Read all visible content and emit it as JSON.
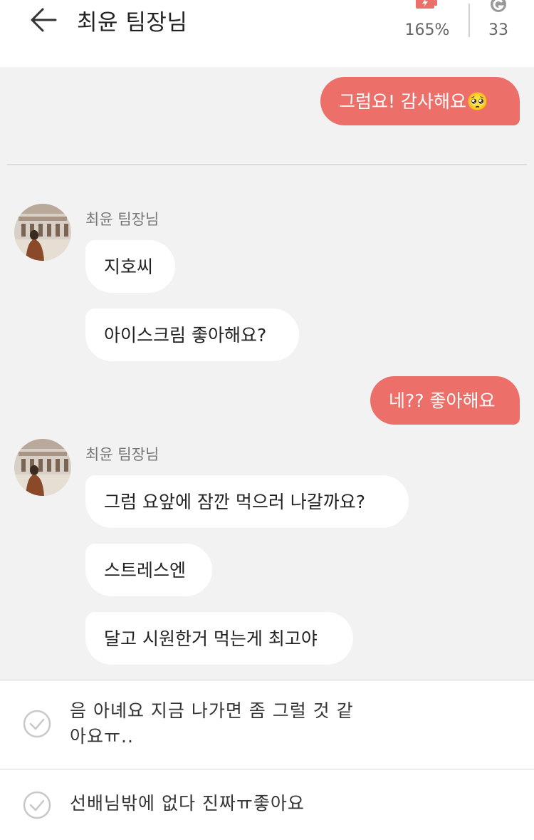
{
  "header": {
    "title": "최윤 팀장님",
    "battery_value": "165%",
    "gem_value": "33",
    "battery_icon": "battery-charging-icon",
    "gem_icon": "g-coin-icon"
  },
  "chat": {
    "messages": [
      {
        "from": "me",
        "text": "그럼요! 감사해요🥺"
      },
      {
        "from": "them",
        "sender": "최윤 팀장님",
        "texts": [
          "지호씨",
          "아이스크림 좋아해요?"
        ]
      },
      {
        "from": "me",
        "text": "네?? 좋아해요"
      },
      {
        "from": "them",
        "sender": "최윤 팀장님",
        "texts": [
          "그럼 요앞에 잠깐 먹으러 나갈까요?",
          "스트레스엔",
          "달고 시원한거 먹는게 최고야"
        ]
      }
    ]
  },
  "options": [
    {
      "text": "음 아녜요 지금 나가면 좀 그럴 것 같아요ㅠ.."
    },
    {
      "text": "선배님밖에 없다 진짜ㅠ좋아요"
    }
  ],
  "colors": {
    "accent": "#ec7069",
    "chat_bg": "#f2f2f2",
    "bubble_in": "#ffffff"
  }
}
